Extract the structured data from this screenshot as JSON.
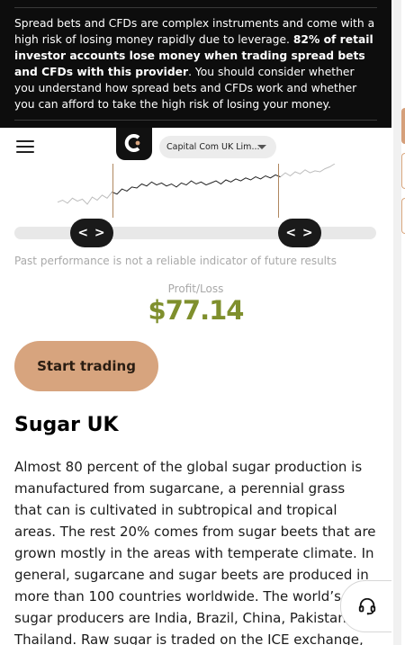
{
  "banner": {
    "text_normal_1": "Spread bets and CFDs are complex instruments and come with a high risk of losing money rapidly due to leverage. ",
    "text_bold": "82% of retail investor accounts lose money when trading spread bets and CFDs with this provider",
    "text_normal_2": ". You should consider whether you understand how spread bets and CFDs work and whether you can afford to take the high risk of losing your money."
  },
  "nav": {
    "entity_select": "Capital Com UK Lim..."
  },
  "chart_data": {
    "type": "line",
    "title": "",
    "series": [
      {
        "values": [
          20,
          22,
          19,
          24,
          21,
          23,
          18,
          25,
          22,
          27,
          24,
          30,
          28,
          33,
          31,
          35,
          34,
          38,
          36,
          40,
          37,
          39,
          36,
          38,
          35,
          39,
          37,
          41,
          38,
          40,
          37,
          39,
          41,
          38,
          42,
          40,
          43,
          41,
          44,
          42,
          45,
          43,
          46,
          44,
          47,
          45,
          49,
          46,
          50,
          48,
          52,
          49,
          51,
          50,
          53,
          55,
          58
        ]
      }
    ],
    "selection": {
      "start_label": "< >",
      "end_label": "< >"
    }
  },
  "disclaimer": "Past performance is not a reliable indicator of future results",
  "profit_loss": {
    "label": "Profit/Loss",
    "value": "$77.14"
  },
  "cta": {
    "start_trading": "Start trading"
  },
  "article": {
    "title": "Sugar UK",
    "body": "Almost 80 percent of the global sugar production is manufactured from sugarcane, a perennial grass that can is cultivated in subtropical and tropical areas. The rest 20% comes from sugar beets that are grown mostly in the areas with temperate climate. In general, sugarcane and sugar beets are produced in more than 100 countries worldwide. The world’s top sugar producers are India, Brazil, China, Pakistan and Thailand. Raw sugar is traded on the ICE exchange,"
  },
  "colors": {
    "accent": "#d7a47e",
    "profit": "#7f8f2d",
    "banner_bg": "#0d0d0d"
  },
  "icons": {
    "menu": "hamburger-icon",
    "logo": "capital-com-logo",
    "support": "headset-icon",
    "caret": "caret-down-icon"
  }
}
